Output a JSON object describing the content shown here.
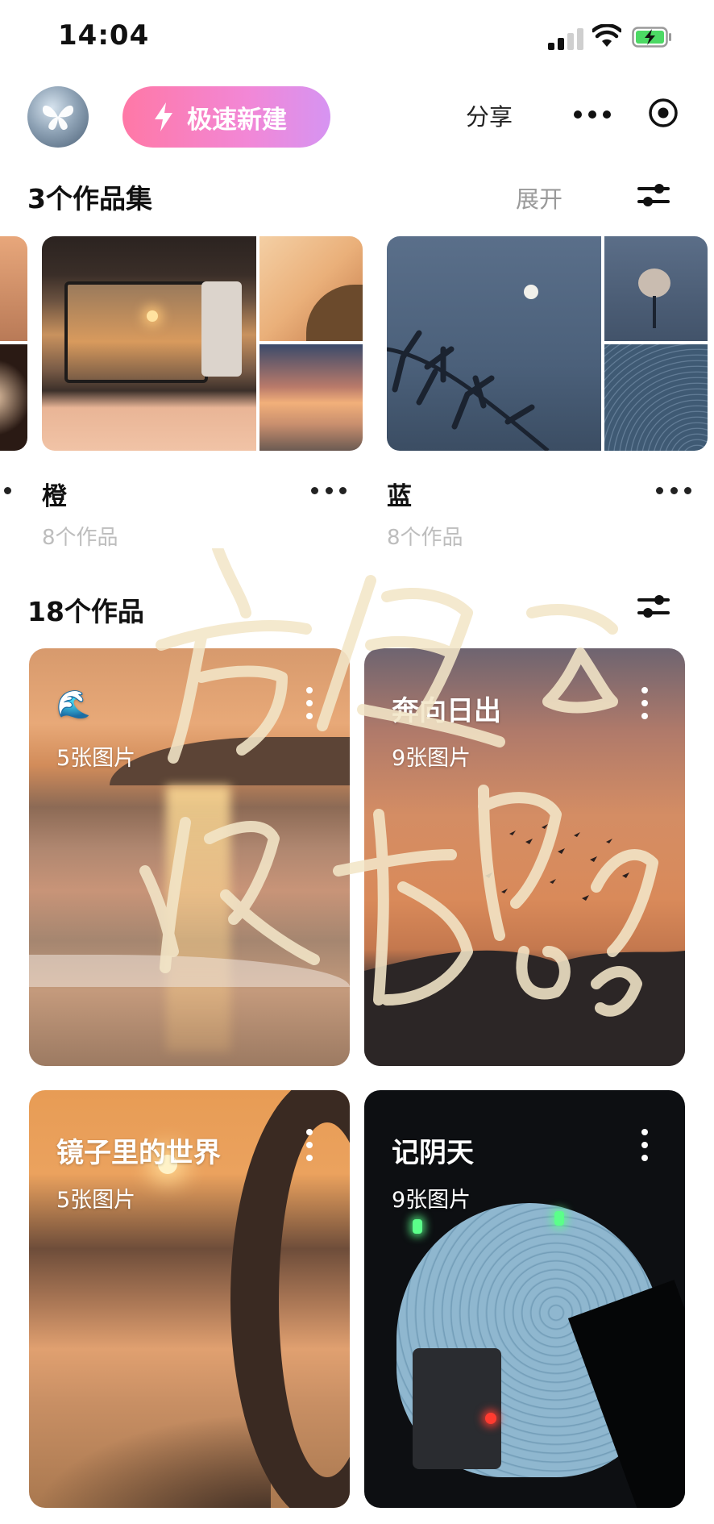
{
  "status_bar": {
    "time": "14:04"
  },
  "header": {
    "quick_new_label": "极速新建",
    "share_label": "分享"
  },
  "collections_section": {
    "title": "3个作品集",
    "expand_label": "展开",
    "items": [
      {
        "name": "橙",
        "count": "8个作品"
      },
      {
        "name": "蓝",
        "count": "8个作品"
      }
    ]
  },
  "works_section": {
    "title": "18个作品",
    "items": [
      {
        "title": "🌊",
        "count": "5张图片"
      },
      {
        "title": "奔向日出",
        "count": "9张图片"
      },
      {
        "title": "镜子里的世界",
        "count": "5张图片"
      },
      {
        "title": "记阴天",
        "count": "9张图片"
      }
    ]
  },
  "overlay": {
    "handwriting": "方便好 快捷器"
  },
  "colors": {
    "accent_gradient_start": "#ff78a6",
    "accent_gradient_end": "#d694f2",
    "muted_text": "#bdbdbd",
    "handwriting": "#f3e6c8"
  }
}
